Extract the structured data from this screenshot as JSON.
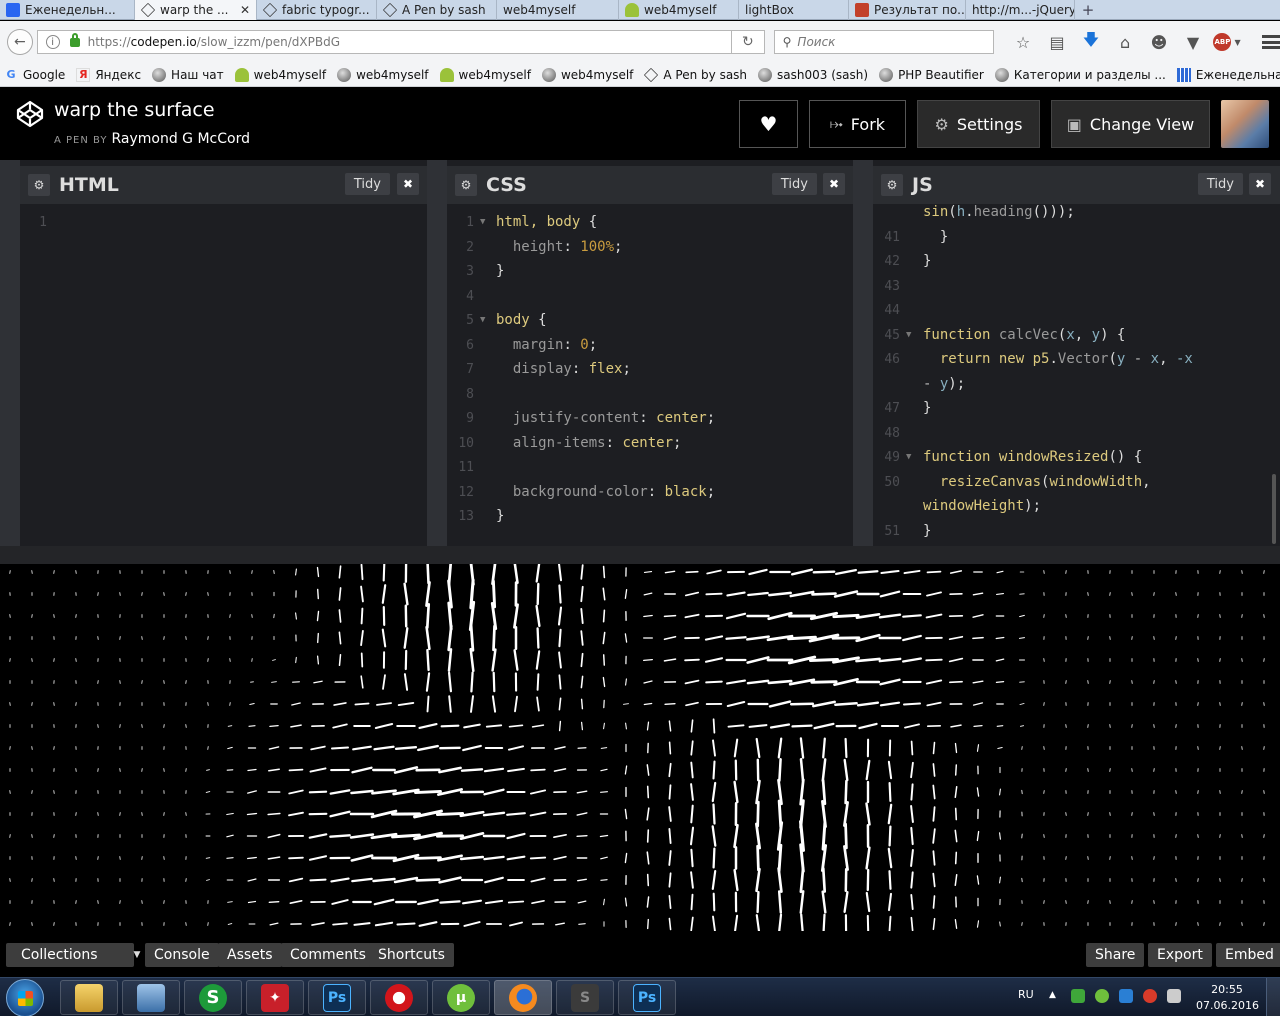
{
  "browser": {
    "tabs": [
      {
        "label": "Еженедельн...",
        "icon": "css-live-icon",
        "active": false,
        "closable": false
      },
      {
        "label": "warp the ...",
        "icon": "codepen-icon",
        "active": true,
        "closable": true
      },
      {
        "label": "fabric typogr...",
        "icon": "codepen-icon",
        "active": false,
        "closable": false
      },
      {
        "label": "A Pen by sash",
        "icon": "codepen-icon",
        "active": false,
        "closable": false
      },
      {
        "label": "web4myself",
        "icon": "none",
        "active": false,
        "closable": false
      },
      {
        "label": "web4myself",
        "icon": "tree-icon",
        "active": false,
        "closable": false
      },
      {
        "label": "lightBox",
        "icon": "none",
        "active": false,
        "closable": false
      },
      {
        "label": "Результат по...",
        "icon": "orange-icon",
        "active": false,
        "closable": false
      },
      {
        "label": "http://m...-jQuery/",
        "icon": "none",
        "active": false,
        "closable": false
      }
    ],
    "new_tab_label": "+",
    "url": {
      "proto": "https://",
      "host": "codepen.io",
      "path": "/slow_izzm/pen/dXPBdG"
    },
    "search_placeholder": "Поиск",
    "bookmarks": [
      {
        "label": "Google",
        "icon": "google-icon"
      },
      {
        "label": "Яндекс",
        "icon": "yandex-icon"
      },
      {
        "label": "Наш чат",
        "icon": "globe-icon"
      },
      {
        "label": "web4myself",
        "icon": "tree-icon"
      },
      {
        "label": "web4myself",
        "icon": "globe-icon"
      },
      {
        "label": "web4myself",
        "icon": "tree-icon"
      },
      {
        "label": "web4myself",
        "icon": "globe-icon"
      },
      {
        "label": "A Pen by sash",
        "icon": "codepen-icon"
      },
      {
        "label": "sash003 (sash)",
        "icon": "globe-icon"
      },
      {
        "label": "PHP Beautifier",
        "icon": "globe-icon"
      },
      {
        "label": "Категории и разделы ...",
        "icon": "globe-icon"
      },
      {
        "label": "Еженедельная подбо...",
        "icon": "grid-icon"
      }
    ]
  },
  "pen": {
    "title": "warp the surface",
    "by_label": "A PEN BY",
    "author": "Raymond G McCord",
    "buttons": {
      "fork": "Fork",
      "settings": "Settings",
      "change_view": "Change View"
    }
  },
  "editors": {
    "html": {
      "title": "HTML",
      "tidy": "Tidy",
      "close": "✖"
    },
    "css": {
      "title": "CSS",
      "tidy": "Tidy",
      "close": "✖"
    },
    "js": {
      "title": "JS",
      "tidy": "Tidy",
      "close": "✖"
    },
    "html_lines": [
      {
        "n": "1",
        "t": ""
      }
    ],
    "css_lines": [
      {
        "n": "1",
        "fold": true,
        "t": [
          [
            "html, body",
            "t-sel"
          ],
          [
            " {",
            "t-p"
          ]
        ]
      },
      {
        "n": "2",
        "t": [
          [
            "  height",
            "t-prop"
          ],
          [
            ": ",
            "t-p"
          ],
          [
            "100%",
            "t-num"
          ],
          [
            ";",
            "t-p"
          ]
        ]
      },
      {
        "n": "3",
        "t": [
          [
            "}",
            "t-p"
          ]
        ]
      },
      {
        "n": "4",
        "t": []
      },
      {
        "n": "5",
        "fold": true,
        "t": [
          [
            "body",
            "t-sel"
          ],
          [
            " {",
            "t-p"
          ]
        ]
      },
      {
        "n": "6",
        "t": [
          [
            "  margin",
            "t-prop"
          ],
          [
            ": ",
            "t-p"
          ],
          [
            "0",
            "t-num"
          ],
          [
            ";",
            "t-p"
          ]
        ]
      },
      {
        "n": "7",
        "t": [
          [
            "  display",
            "t-prop"
          ],
          [
            ": ",
            "t-p"
          ],
          [
            "flex",
            "t-kw"
          ],
          [
            ";",
            "t-p"
          ]
        ]
      },
      {
        "n": "8",
        "t": []
      },
      {
        "n": "9",
        "t": [
          [
            "  justify-content",
            "t-prop"
          ],
          [
            ": ",
            "t-p"
          ],
          [
            "center",
            "t-kw"
          ],
          [
            ";",
            "t-p"
          ]
        ]
      },
      {
        "n": "10",
        "t": [
          [
            "  align-items",
            "t-prop"
          ],
          [
            ": ",
            "t-p"
          ],
          [
            "center",
            "t-kw"
          ],
          [
            ";",
            "t-p"
          ]
        ]
      },
      {
        "n": "11",
        "t": []
      },
      {
        "n": "12",
        "t": [
          [
            "  background-color",
            "t-prop"
          ],
          [
            ": ",
            "t-p"
          ],
          [
            "black",
            "t-kw"
          ],
          [
            ";",
            "t-p"
          ]
        ]
      },
      {
        "n": "13",
        "t": [
          [
            "}",
            "t-p"
          ]
        ]
      }
    ],
    "js_lines": [
      {
        "n": "",
        "t": [
          [
            "sin",
            "t-kw"
          ],
          [
            "(",
            "t-p"
          ],
          [
            "h",
            "t-var"
          ],
          [
            ".",
            "t-p"
          ],
          [
            "heading",
            "t-dim"
          ],
          [
            "()));",
            "t-p"
          ]
        ]
      },
      {
        "n": "41",
        "t": [
          [
            "  }",
            "t-p"
          ]
        ]
      },
      {
        "n": "42",
        "t": [
          [
            "}",
            "t-p"
          ]
        ]
      },
      {
        "n": "43",
        "t": []
      },
      {
        "n": "44",
        "t": []
      },
      {
        "n": "45",
        "fold": true,
        "t": [
          [
            "function",
            "t-kw"
          ],
          [
            " ",
            "t-p"
          ],
          [
            "calcVec",
            "t-dim"
          ],
          [
            "(",
            "t-p"
          ],
          [
            "x",
            "t-var"
          ],
          [
            ", ",
            "t-p"
          ],
          [
            "y",
            "t-var"
          ],
          [
            ") {",
            "t-p"
          ]
        ]
      },
      {
        "n": "46",
        "t": [
          [
            "  return",
            "t-kw"
          ],
          [
            " new ",
            "t-kw"
          ],
          [
            "p5",
            "t-kw"
          ],
          [
            ".",
            "t-p"
          ],
          [
            "Vector",
            "t-dim"
          ],
          [
            "(",
            "t-p"
          ],
          [
            "y",
            "t-var"
          ],
          [
            " - ",
            "t-op"
          ],
          [
            "x",
            "t-var"
          ],
          [
            ", ",
            "t-p"
          ],
          [
            "-x",
            "t-var"
          ]
        ]
      },
      {
        "n": "",
        "t": [
          [
            "- ",
            "t-op"
          ],
          [
            "y",
            "t-var"
          ],
          [
            ");",
            "t-p"
          ]
        ]
      },
      {
        "n": "47",
        "t": [
          [
            "}",
            "t-p"
          ]
        ]
      },
      {
        "n": "48",
        "t": []
      },
      {
        "n": "49",
        "fold": true,
        "t": [
          [
            "function",
            "t-kw"
          ],
          [
            " ",
            "t-p"
          ],
          [
            "windowResized",
            "t-kw"
          ],
          [
            "() {",
            "t-p"
          ]
        ]
      },
      {
        "n": "50",
        "t": [
          [
            "  resizeCanvas",
            "t-kw"
          ],
          [
            "(",
            "t-p"
          ],
          [
            "windowWidth",
            "t-kw"
          ],
          [
            ",",
            "t-p"
          ]
        ]
      },
      {
        "n": "",
        "t": [
          [
            "windowHeight",
            "t-kw"
          ],
          [
            ");",
            "t-p"
          ]
        ]
      },
      {
        "n": "51",
        "t": [
          [
            "}",
            "t-p"
          ]
        ]
      }
    ]
  },
  "footer": {
    "left": [
      "Collections",
      "Console",
      "Assets",
      "Comments",
      "Shortcuts"
    ],
    "right": [
      "Share",
      "Export",
      "Embed"
    ]
  },
  "taskbar": {
    "apps": [
      "explorer-icon",
      "network-icon",
      "s-app-icon",
      "pdf-icon",
      "photoshop-icon",
      "opera-icon",
      "utorrent-icon",
      "firefox-icon",
      "sublime-icon",
      "photoshop-icon"
    ],
    "app_letters": {
      "s-app-icon": "S",
      "photoshop-icon": "Ps"
    },
    "lang": "RU",
    "time": "20:55",
    "date": "07.06.2016"
  },
  "colors": {
    "editor_bg": "#1d1e22",
    "header_bg": "#000000",
    "keyword": "#ddca7e",
    "property": "#9a9a9a",
    "number": "#c99c3f",
    "variable": "#88afbf"
  }
}
